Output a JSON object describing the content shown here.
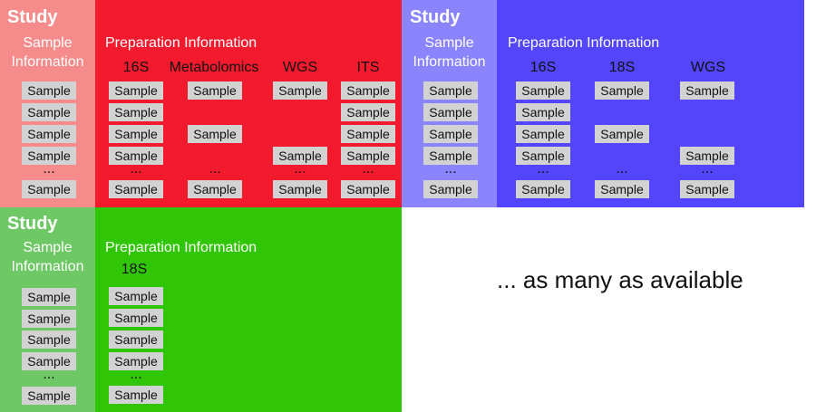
{
  "panels": [
    {
      "study_title": "Study",
      "sample_info_label": "Sample\nInformation",
      "prep_info_label": "Preparation Information",
      "colors": {
        "study": "#f58b8b",
        "prep": "#f41a2e"
      },
      "sample_label": "Sample",
      "dots": "...",
      "columns": [
        "16S",
        "Metabolomics",
        "WGS",
        "ITS"
      ]
    },
    {
      "study_title": "Study",
      "sample_info_label": "Sample\nInformation",
      "prep_info_label": "Preparation Information",
      "colors": {
        "study": "#8b84ff",
        "prep": "#5245fb"
      },
      "sample_label": "Sample",
      "dots": "...",
      "columns": [
        "16S",
        "18S",
        "WGS"
      ]
    },
    {
      "study_title": "Study",
      "sample_info_label": "Sample\nInformation",
      "prep_info_label": "Preparation Information",
      "colors": {
        "study": "#6fc866",
        "prep": "#31c605"
      },
      "sample_label": "Sample",
      "dots": "...",
      "columns": [
        "18S"
      ]
    }
  ],
  "more_text": "... as many as available"
}
